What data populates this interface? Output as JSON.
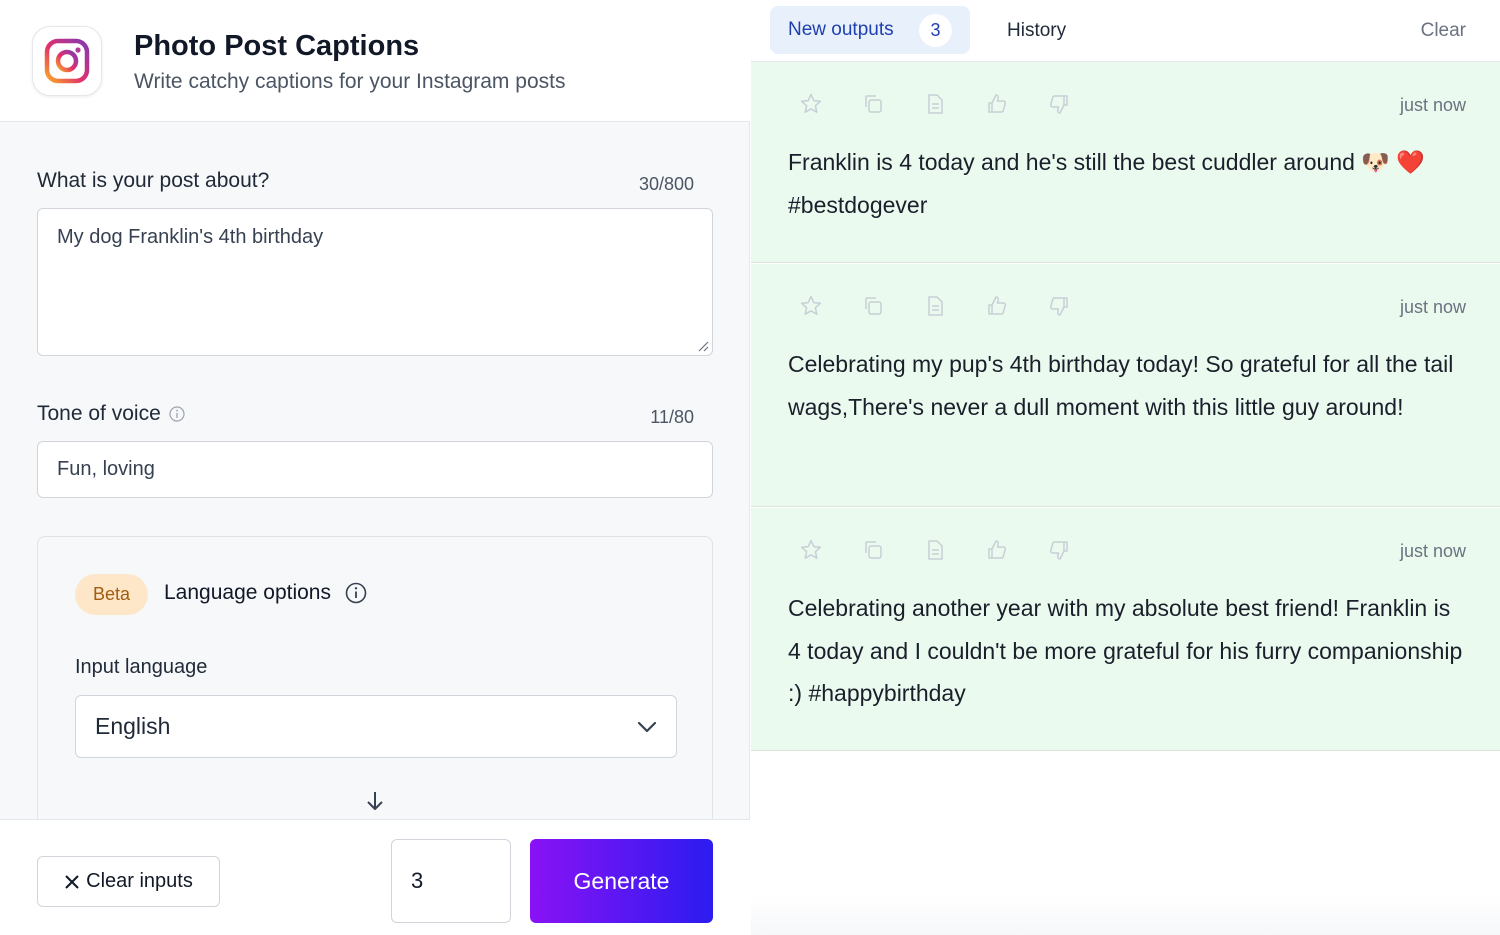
{
  "colors": {
    "accent": "#1e40af",
    "output_bg": "#ebfaef",
    "generate_start": "#8a12f5",
    "generate_end": "#2b1cf0",
    "beta_bg": "#fde7c8"
  },
  "header": {
    "title": "Photo Post Captions",
    "subtitle": "Write catchy captions for your Instagram posts",
    "icon": "instagram-icon"
  },
  "form": {
    "post_about": {
      "label": "What is your post about?",
      "counter": "30/800",
      "value": "My dog Franklin's 4th birthday"
    },
    "tone": {
      "label": "Tone of voice",
      "counter": "11/80",
      "value": "Fun, loving"
    },
    "language": {
      "badge": "Beta",
      "title": "Language options",
      "input_label": "Input language",
      "input_value": "English"
    }
  },
  "footer": {
    "clear_label": "Clear inputs",
    "quantity": "3",
    "generate_label": "Generate"
  },
  "outputs_panel": {
    "tab_new": "New outputs",
    "tab_new_count": "3",
    "tab_history": "History",
    "clear_label": "Clear",
    "items": [
      {
        "time": "just now",
        "text": "Franklin is 4 today and he's still the best cuddler around 🐶 ❤️ #bestdogever"
      },
      {
        "time": "just now",
        "text": "Celebrating my pup's 4th birthday today! So grateful for all the tail wags,There's never a dull moment with this little guy around!"
      },
      {
        "time": "just now",
        "text": "Celebrating another year with my absolute best friend! Franklin is 4 today and I couldn't be more grateful for his furry companionship :) #happybirthday"
      }
    ]
  }
}
